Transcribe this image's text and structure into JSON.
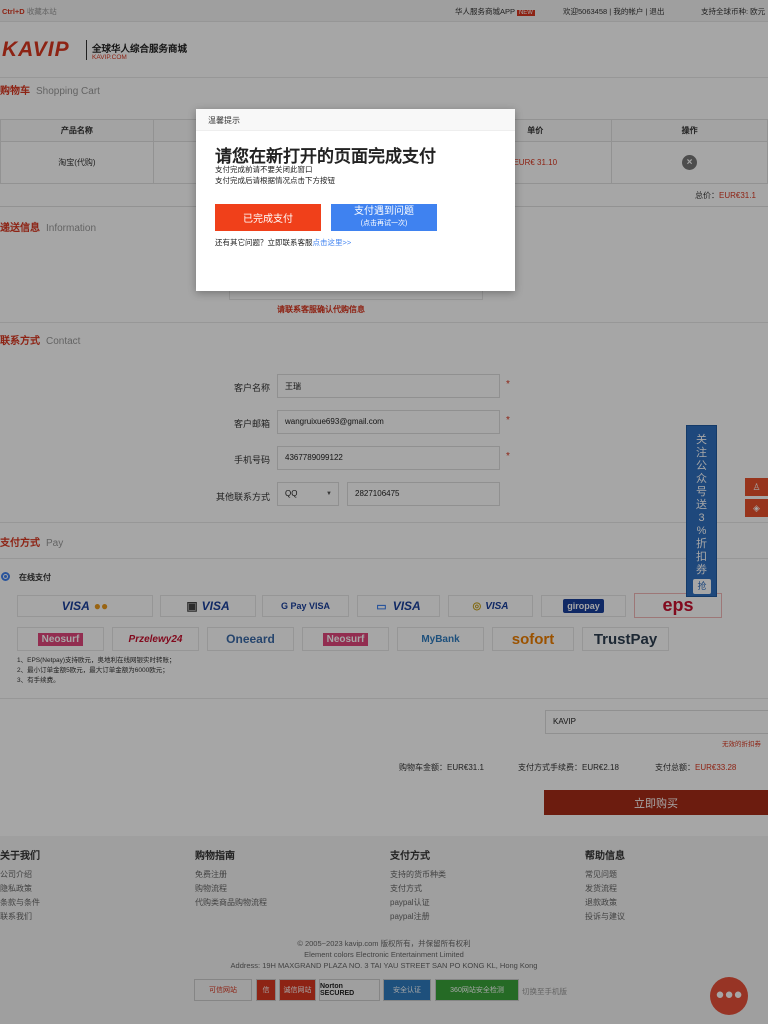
{
  "topbar": {
    "bookmark_key": "Ctrl+D",
    "bookmark_text": "收藏本站",
    "app_link": "华人服务商城APP",
    "app_badge": "NEW",
    "welcome": "欢迎5063458 | 我的帐户 | 退出",
    "currency": "支持全球币种: 欧元"
  },
  "header": {
    "logo": "KAVIP",
    "slogan": "全球华人综合服务商城",
    "domain": "KAVIP.COM"
  },
  "cart": {
    "title_cn": "购物车",
    "title_en": "Shopping Cart",
    "columns": [
      "产品名称",
      "",
      "",
      "单价",
      "操作"
    ],
    "row": {
      "name": "淘宝(代购)",
      "price": "EUR€ 31.10"
    },
    "total_label": "总价：",
    "total_value": "EUR€31.1"
  },
  "delivery": {
    "title_cn": "递送信息",
    "title_en": "Information",
    "notice": "请联系客服确认代购信息"
  },
  "contact": {
    "title_cn": "联系方式",
    "title_en": "Contact",
    "name_label": "客户名称",
    "name_value": "王瑞",
    "email_label": "客户邮箱",
    "email_value": "wangruixue693@gmail.com",
    "phone_label": "手机号码",
    "phone_value": "4367789099122",
    "other_label": "其他联系方式",
    "other_type": "QQ",
    "other_value": "2827106475",
    "required_mark": "*"
  },
  "payment": {
    "title_cn": "支付方式",
    "title_en": "Pay",
    "option_label": "在线支付",
    "logos_row1": [
      "VISA",
      "VISA",
      "G Pay VISA",
      "VISA",
      "VISA",
      "giropay",
      "eps"
    ],
    "logos_row2": [
      "Neosurf",
      "Przelewy24",
      "Oneeard",
      "Neosurf",
      "MyBank",
      "sofort",
      "TrustPay"
    ],
    "notes": [
      "1、EPS(Netpay)支持欧元，奥地利在线网银实时转账；",
      "2、最小订单金额5欧元，最大订单金额为6000欧元；",
      "3、有手续费。"
    ]
  },
  "coupon": {
    "value": "KAVIP",
    "invalid_text": "无效的折扣券"
  },
  "summary": {
    "cart_amount_label": "购物车金额：",
    "cart_amount": "EUR€31.1",
    "fee_label": "支付方式手续费：",
    "fee": "EUR€2.18",
    "total_label": "支付总额：",
    "total": "EUR€33.28",
    "buy_button": "立即购买"
  },
  "side_banner": {
    "text": "关注公众号送3%折扣券",
    "button": "抢"
  },
  "footer": {
    "columns": [
      {
        "title": "关于我们",
        "items": [
          "公司介绍",
          "隐私政策",
          "条款与条件",
          "联系我们"
        ]
      },
      {
        "title": "购物指南",
        "items": [
          "免费注册",
          "购物流程",
          "代购类商品购物流程"
        ]
      },
      {
        "title": "支付方式",
        "items": [
          "支持的货币种类",
          "支付方式",
          "paypal认证",
          "paypal注册"
        ]
      },
      {
        "title": "帮助信息",
        "items": [
          "常见问题",
          "发货流程",
          "退款政策",
          "投诉与建议"
        ]
      }
    ],
    "copyright": "© 2005~2023 kavip.com 版权所有，并保留所有权利",
    "company": "Element colors Electronic Entertainment Limited",
    "address": "Address: 19H MAXGRAND PLAZA NO. 3 TAI YAU STREET SAN PO KONG KL, Hong Kong",
    "badges": [
      "可信网站",
      "信",
      "诚信网站",
      "Norton SECURED",
      "安全认证",
      "360网站安全检测"
    ],
    "mobile_link": "切换至手机版"
  },
  "modal": {
    "header": "温馨提示",
    "title": "请您在新打开的页面完成支付",
    "line1": "支付完成前请不要关闭此窗口",
    "line2": "支付完成后请根据情况点击下方按钮",
    "done_button": "已完成支付",
    "problem_button": "支付遇到问题",
    "problem_sub": "(点击再试一次)",
    "help_text": "还有其它问题？立即联系客服",
    "help_link": "点击这里>>"
  },
  "colors": {
    "accent": "#d9361f",
    "buy_button": "#a72b17",
    "primary_blue": "#3f82f0",
    "side_banner": "#2f6fbf"
  }
}
